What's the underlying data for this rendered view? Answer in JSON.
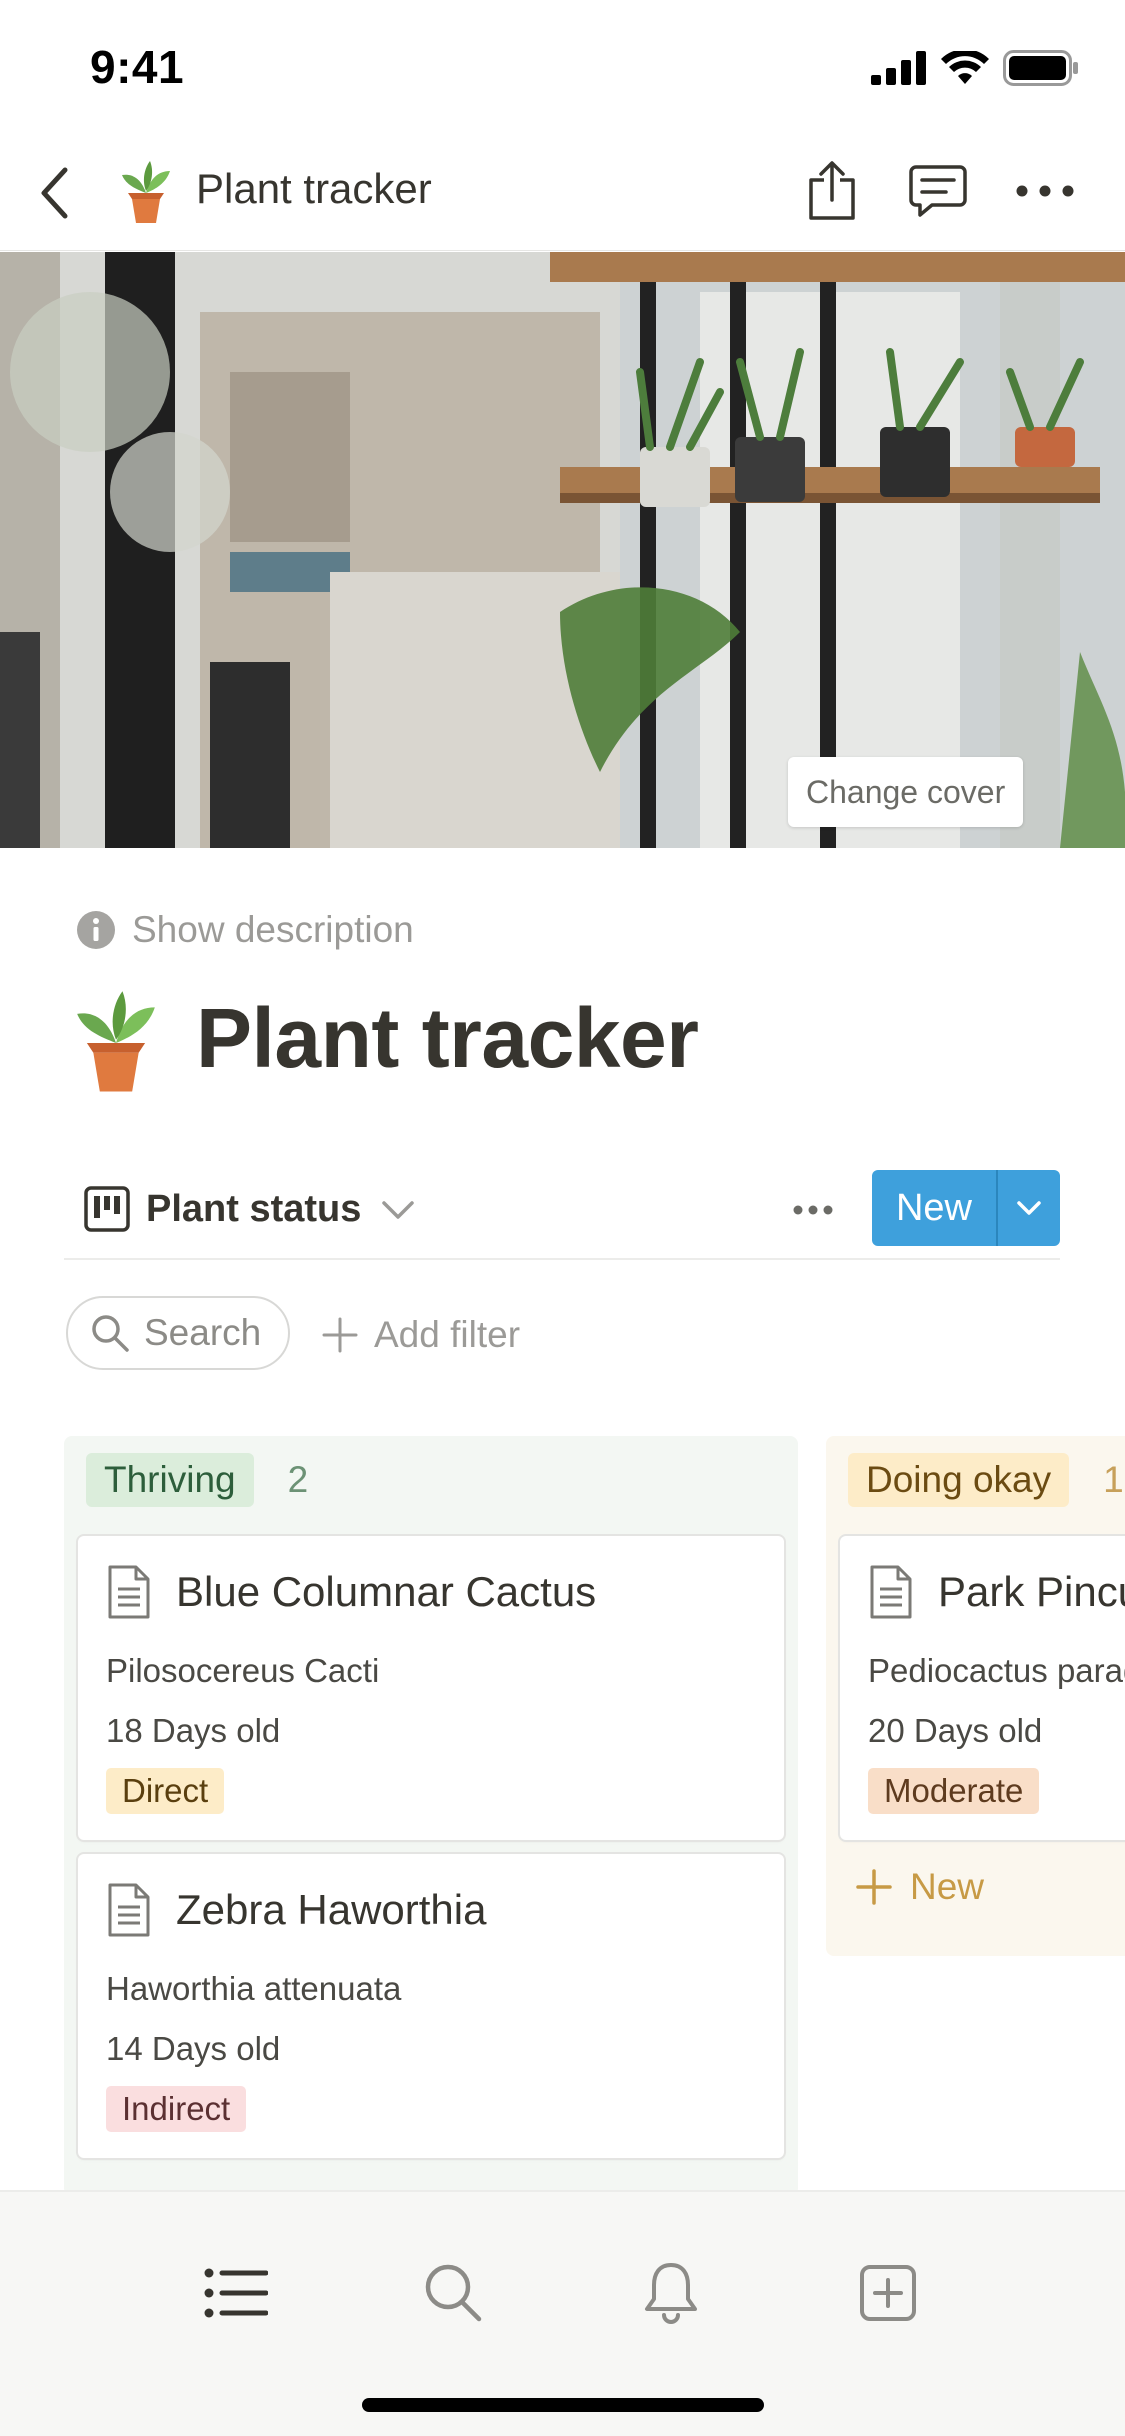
{
  "status_bar": {
    "time": "9:41"
  },
  "nav": {
    "title": "Plant tracker"
  },
  "cover": {
    "change_cover_label": "Change cover"
  },
  "page": {
    "show_description_label": "Show description",
    "title": "Plant tracker"
  },
  "view": {
    "name": "Plant status",
    "new_label": "New"
  },
  "filters": {
    "search_label": "Search",
    "add_filter_label": "Add filter"
  },
  "board": {
    "columns": [
      {
        "tag": "Thriving",
        "count": "2",
        "cards": [
          {
            "title": "Blue Columnar Cactus",
            "species": "Pilosocereus Cacti",
            "age": "18 Days old",
            "light": "Direct"
          },
          {
            "title": "Zebra Haworthia",
            "species": "Haworthia attenuata",
            "age": "14 Days old",
            "light": "Indirect"
          }
        ]
      },
      {
        "tag": "Doing okay",
        "count": "1",
        "cards": [
          {
            "title": "Park Pincushion",
            "species": "Pediocactus paradinei",
            "age": "20 Days old",
            "light": "Moderate"
          }
        ],
        "new_label": "New"
      }
    ]
  },
  "colors": {
    "accent_blue": "#3ea0dc",
    "thriving_bg": "#dbeddb",
    "okay_bg": "#fdecc8",
    "text": "#37352f"
  }
}
